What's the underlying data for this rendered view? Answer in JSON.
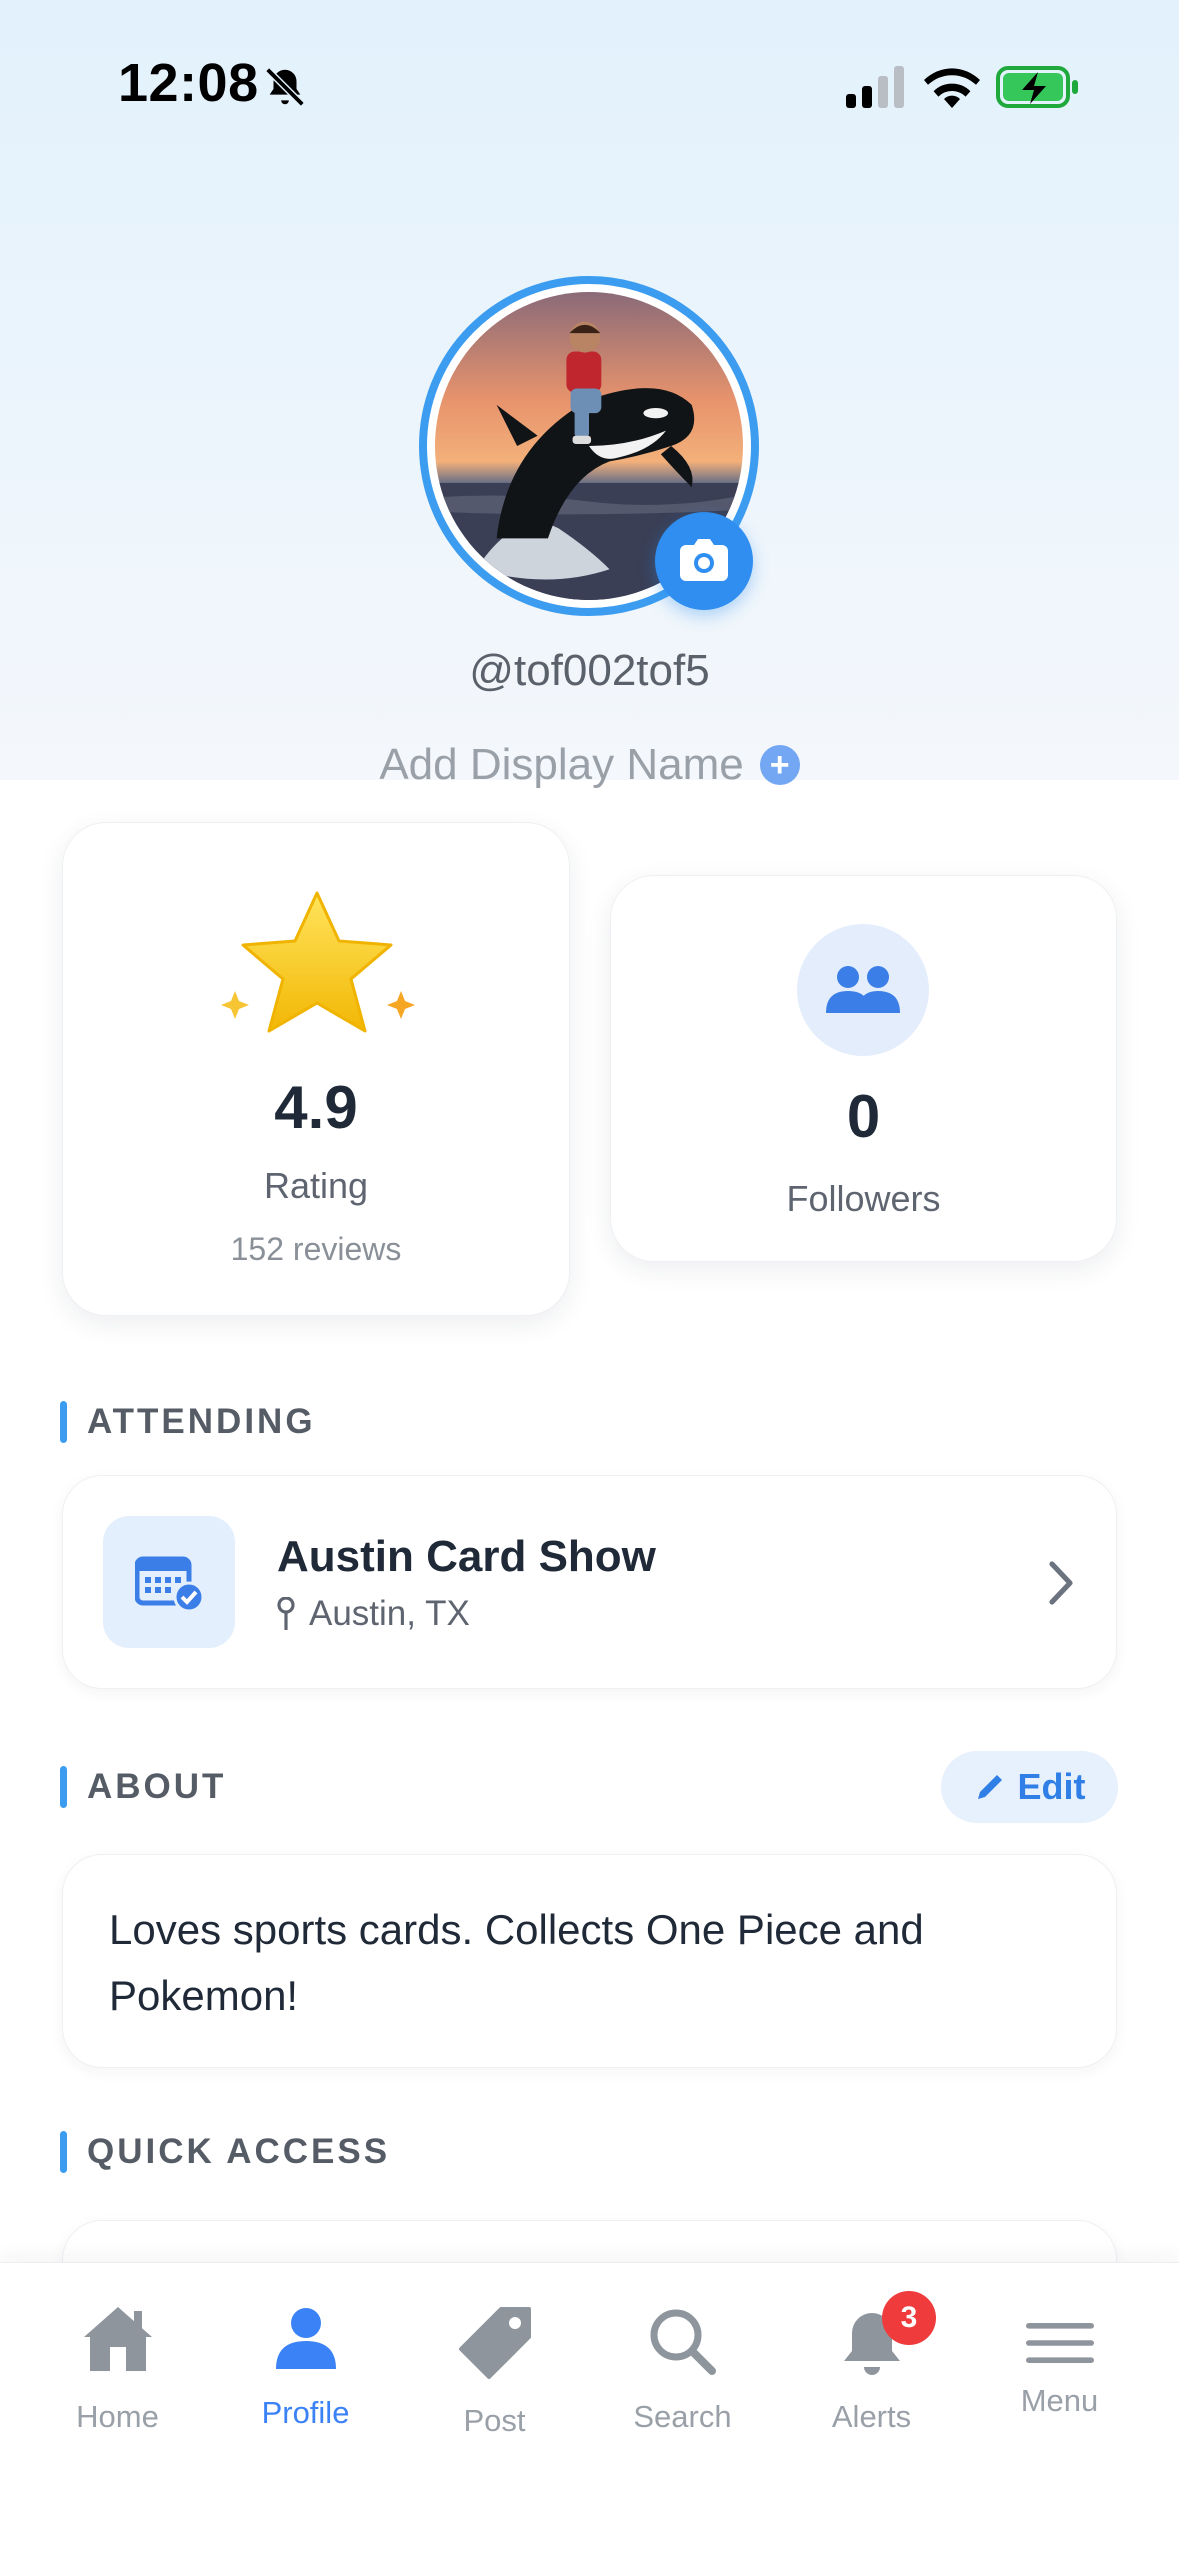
{
  "status_bar": {
    "time": "12:08",
    "icons": [
      "bell-slash-icon",
      "cellular-signal-icon",
      "wifi-icon",
      "battery-charging-icon"
    ]
  },
  "profile": {
    "username": "@tof002tof5",
    "add_display_name": "Add Display Name",
    "add_icon": "plus-circle-icon",
    "camera_icon": "camera-icon"
  },
  "stats": {
    "rating": {
      "value": "4.9",
      "label": "Rating",
      "reviews": "152 reviews",
      "icon": "star-icon"
    },
    "followers": {
      "value": "0",
      "label": "Followers",
      "icon": "people-icon"
    }
  },
  "attending": {
    "section_title": "ATTENDING",
    "event": {
      "title": "Austin Card Show",
      "location": "Austin, TX",
      "icon": "calendar-check-icon"
    }
  },
  "about": {
    "section_title": "ABOUT",
    "edit_label": "Edit",
    "text": "Loves sports cards. Collects One Piece and Pokemon!"
  },
  "quick_access": {
    "section_title": "QUICK ACCESS"
  },
  "tab_bar": {
    "tabs": [
      {
        "label": "Home",
        "icon": "home-icon",
        "active": false
      },
      {
        "label": "Profile",
        "icon": "person-icon",
        "active": true
      },
      {
        "label": "Post",
        "icon": "tag-icon",
        "active": false
      },
      {
        "label": "Search",
        "icon": "search-icon",
        "active": false
      },
      {
        "label": "Alerts",
        "icon": "bell-icon",
        "active": false,
        "badge": "3"
      },
      {
        "label": "Menu",
        "icon": "menu-icon",
        "active": false
      }
    ]
  },
  "colors": {
    "accent": "#3b9cf0",
    "active_tab": "#3b82f6",
    "badge": "#ef3b3b",
    "star": "#f5c518"
  }
}
